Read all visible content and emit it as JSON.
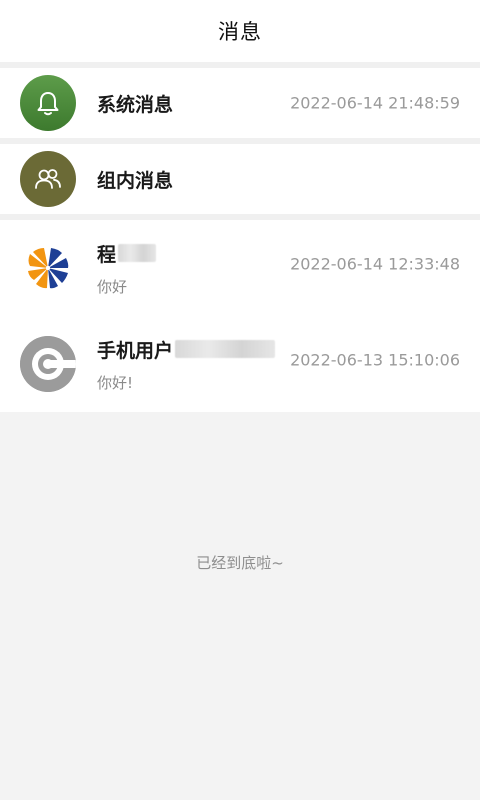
{
  "header": {
    "title": "消息"
  },
  "system_row": {
    "label": "系统消息",
    "time": "2022-06-14 21:48:59",
    "icon": "bell-icon"
  },
  "group_row": {
    "label": "组内消息",
    "icon": "group-icon"
  },
  "chats": [
    {
      "name": "程",
      "preview": "你好",
      "time": "2022-06-14 12:33:48",
      "avatar": "orange-blue-logo"
    },
    {
      "name": "手机用户",
      "preview": "你好!",
      "time": "2022-06-13 15:10:06",
      "avatar": "grey-disc-logo"
    }
  ],
  "footer": {
    "tip": "已经到底啦~"
  },
  "colors": {
    "accent_green": "#4a8a3b",
    "group_olive": "#6b6a36",
    "background": "#f3f3f3"
  }
}
